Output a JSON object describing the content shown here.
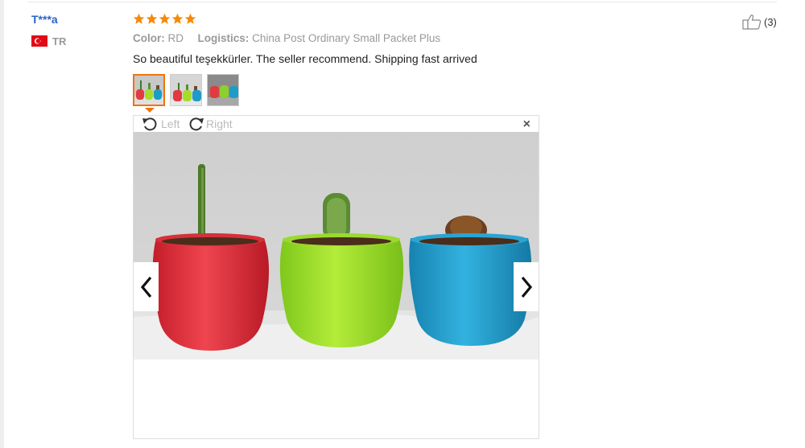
{
  "review": {
    "user_name": "T***a",
    "country_code": "TR",
    "rating_stars": 5,
    "color_label": "Color:",
    "color_value": "RD",
    "logistics_label": "Logistics:",
    "logistics_value": "China Post Ordinary Small Packet Plus",
    "text": "So beautiful teşekkürler. The seller recommend. Shipping fast arrived",
    "helpful_count": "(3)",
    "selected_thumbnail": 1,
    "thumbnail_count": 3
  },
  "viewer": {
    "rotate_left_label": "Left",
    "rotate_right_label": "Right",
    "close_glyph": "×"
  },
  "colors": {
    "username_blue": "#2b63c6",
    "star_orange": "#f58a0a",
    "thumbnail_active_border": "#f0740a",
    "muted_gray": "#999999"
  },
  "icons": {
    "rating": "star-icon",
    "flag": "turkey-flag-icon",
    "rotate_left": "rotate-left-icon",
    "rotate_right": "rotate-right-icon",
    "close": "close-icon",
    "prev": "chevron-left-icon",
    "next": "chevron-right-icon",
    "helpful": "thumbs-up-icon"
  }
}
